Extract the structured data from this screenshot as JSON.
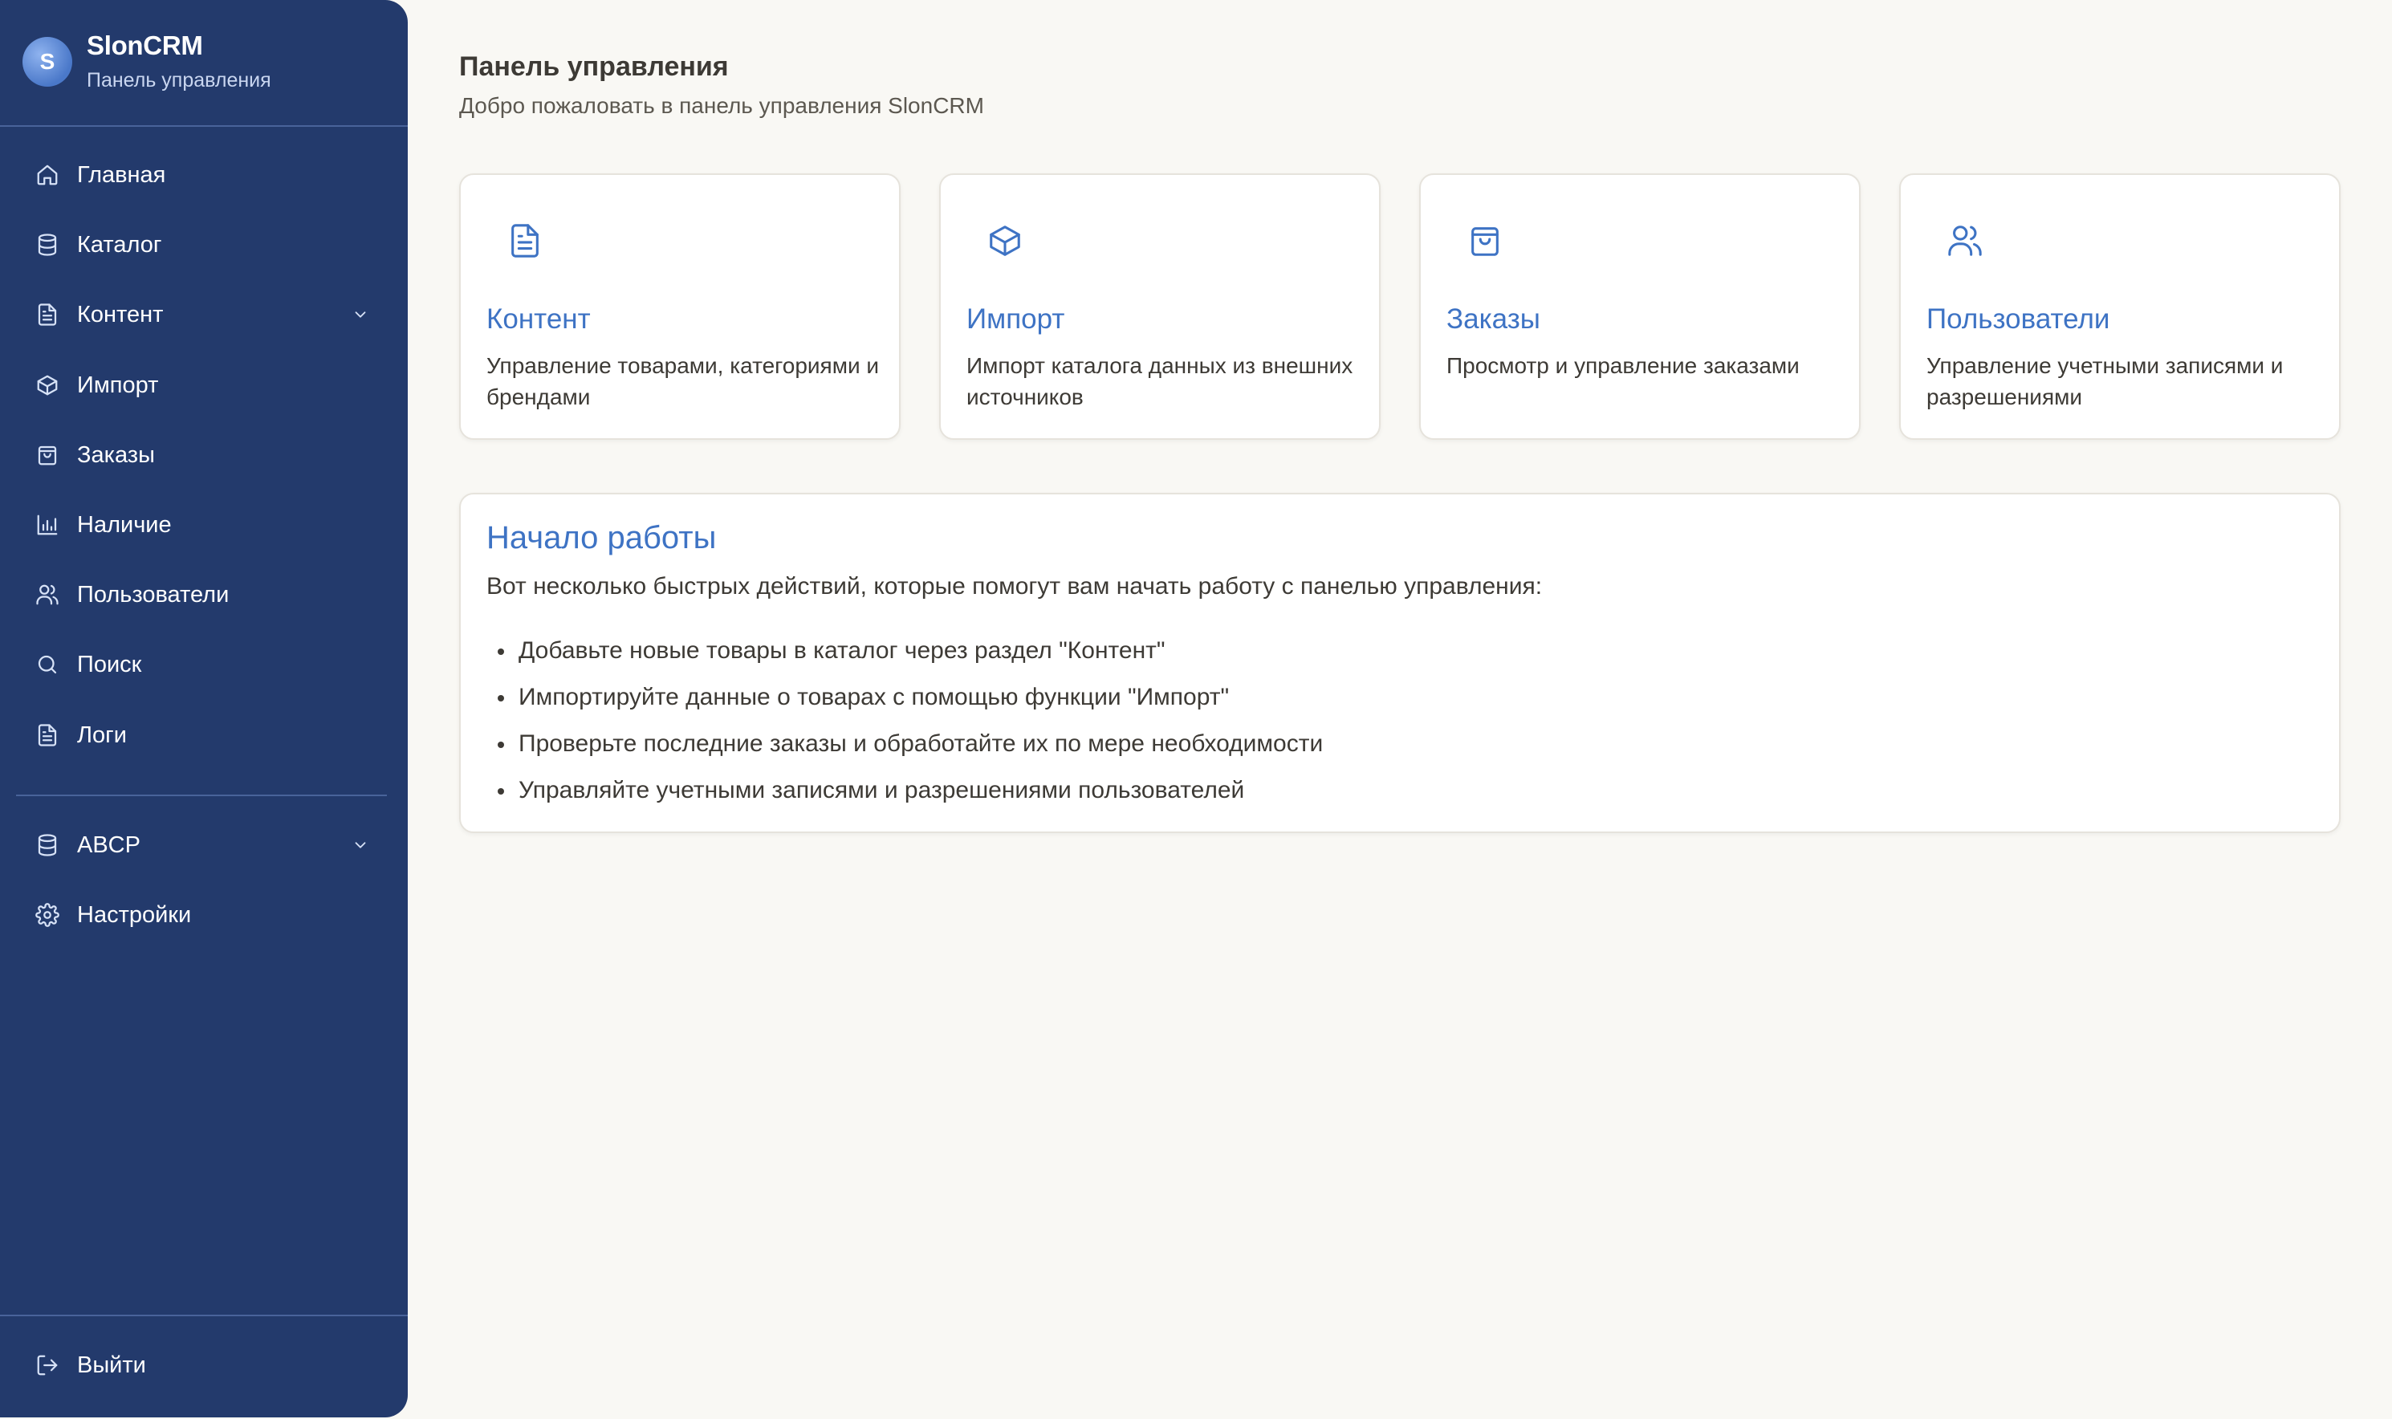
{
  "brand": {
    "logo_letter": "S",
    "name": "SlonCRM",
    "subtitle": "Панель управления"
  },
  "sidebar": {
    "items": [
      {
        "label": "Главная",
        "icon": "home-icon"
      },
      {
        "label": "Каталог",
        "icon": "database-icon"
      },
      {
        "label": "Контент",
        "icon": "document-icon",
        "expandable": true
      },
      {
        "label": "Импорт",
        "icon": "box-icon"
      },
      {
        "label": "Заказы",
        "icon": "shopping-bag-icon"
      },
      {
        "label": "Наличие",
        "icon": "bar-chart-icon"
      },
      {
        "label": "Пользователи",
        "icon": "users-icon"
      },
      {
        "label": "Поиск",
        "icon": "search-icon"
      },
      {
        "label": "Логи",
        "icon": "document-icon"
      }
    ],
    "secondary_items": [
      {
        "label": "ABCP",
        "icon": "database-icon",
        "expandable": true
      },
      {
        "label": "Настройки",
        "icon": "gear-icon"
      }
    ],
    "logout": {
      "label": "Выйти",
      "icon": "logout-icon"
    }
  },
  "header": {
    "title": "Панель управления",
    "subtitle": "Добро пожаловать в панель управления SlonCRM"
  },
  "cards": [
    {
      "title": "Контент",
      "description": "Управление товарами, категориями и брендами",
      "icon": "document-icon"
    },
    {
      "title": "Импорт",
      "description": "Импорт каталога данных из внешних источников",
      "icon": "box-icon"
    },
    {
      "title": "Заказы",
      "description": "Просмотр и управление заказами",
      "icon": "shopping-bag-icon"
    },
    {
      "title": "Пользователи",
      "description": "Управление учетными записями и разрешениями",
      "icon": "users-icon"
    }
  ],
  "getting_started": {
    "title": "Начало работы",
    "intro": "Вот несколько быстрых действий, которые помогут вам начать работу с панелью управления:",
    "items": [
      "Добавьте новые товары в каталог через раздел \"Контент\"",
      "Импортируйте данные о товарах с помощью функции \"Импорт\"",
      "Проверьте последние заказы и обработайте их по мере необходимости",
      "Управляйте учетными записями и разрешениями пользователей"
    ]
  },
  "colors": {
    "sidebar_bg": "#233a6c",
    "accent": "#3e73c4",
    "page_bg": "#f9f8f4"
  }
}
